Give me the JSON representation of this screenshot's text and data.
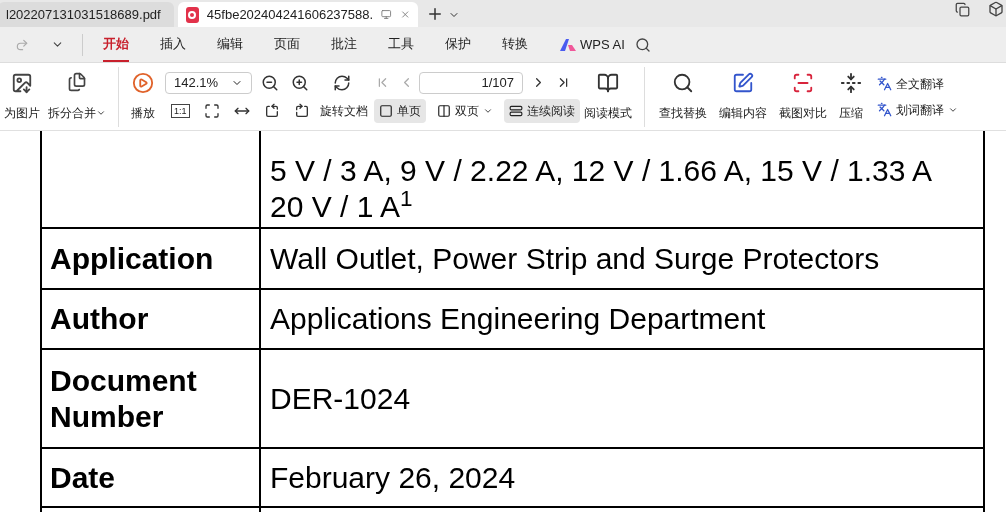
{
  "tabs": [
    {
      "title": "l202207131031518689.pdf",
      "selected": false
    },
    {
      "title": "45fbe202404241606237588.",
      "selected": true
    }
  ],
  "menu": {
    "items": [
      {
        "label": "开始",
        "selected": true
      },
      {
        "label": "插入",
        "selected": false
      },
      {
        "label": "编辑",
        "selected": false
      },
      {
        "label": "页面",
        "selected": false
      },
      {
        "label": "批注",
        "selected": false
      },
      {
        "label": "工具",
        "selected": false
      },
      {
        "label": "保护",
        "selected": false
      },
      {
        "label": "转换",
        "selected": false
      }
    ],
    "ai_label": "WPS AI"
  },
  "toolbar": {
    "left": [
      {
        "label": "为图片",
        "dropdown": false
      },
      {
        "label": "拆分合并",
        "dropdown": true
      }
    ],
    "play": "播放",
    "zoom": "142.1%",
    "actual_size": "1:1",
    "page": "1/107",
    "rotate": "旋转文档",
    "views": [
      {
        "label": "单页",
        "selected": true,
        "dropdown": false
      },
      {
        "label": "双页",
        "selected": false,
        "dropdown": true
      },
      {
        "label": "连续阅读",
        "selected": true,
        "dropdown": false
      }
    ],
    "reading_mode": "阅读模式",
    "tools": [
      "查找替换",
      "编辑内容",
      "截图对比",
      "压缩"
    ],
    "translate": [
      {
        "label": "全文翻译",
        "dropdown": false
      },
      {
        "label": "划词翻译",
        "dropdown": true
      }
    ]
  },
  "document": {
    "rows": [
      {
        "lines": [
          "5 V / 3 A, 9 V / 2.22 A, 12 V / 1.66 A, 15 V / 1.33 A",
          "20 V / 1 A$^{1}$"
        ]
      },
      {
        "label": "Application",
        "lines": [
          "Wall Outlet, Power Strip and Surge Protectors"
        ]
      },
      {
        "label": "Author",
        "lines": [
          "Applications Engineering Department"
        ]
      },
      {
        "label": "Document Number",
        "lines": [
          "DER-1024"
        ]
      },
      {
        "label": "Date",
        "lines": [
          "February 26, 2024"
        ]
      },
      {
        "lines": []
      }
    ]
  }
}
